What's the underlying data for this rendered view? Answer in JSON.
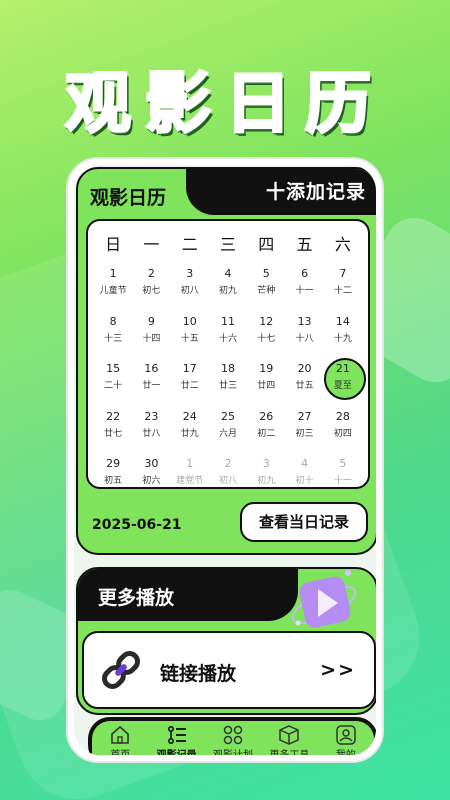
{
  "hero": {
    "title": "观影日历"
  },
  "calendar": {
    "title": "观影日历",
    "add_label": "十添加记录",
    "weekdays": [
      "日",
      "一",
      "二",
      "三",
      "四",
      "五",
      "六"
    ],
    "selected_date": "2025-06-21",
    "view_button": "查看当日记录",
    "days": [
      {
        "n": "1",
        "l": "儿童节"
      },
      {
        "n": "2",
        "l": "初七"
      },
      {
        "n": "3",
        "l": "初八"
      },
      {
        "n": "4",
        "l": "初九"
      },
      {
        "n": "5",
        "l": "芒种"
      },
      {
        "n": "6",
        "l": "十一"
      },
      {
        "n": "7",
        "l": "十二"
      },
      {
        "n": "8",
        "l": "十三"
      },
      {
        "n": "9",
        "l": "十四"
      },
      {
        "n": "10",
        "l": "十五"
      },
      {
        "n": "11",
        "l": "十六"
      },
      {
        "n": "12",
        "l": "十七"
      },
      {
        "n": "13",
        "l": "十八"
      },
      {
        "n": "14",
        "l": "十九"
      },
      {
        "n": "15",
        "l": "二十"
      },
      {
        "n": "16",
        "l": "廿一"
      },
      {
        "n": "17",
        "l": "廿二"
      },
      {
        "n": "18",
        "l": "廿三"
      },
      {
        "n": "19",
        "l": "廿四"
      },
      {
        "n": "20",
        "l": "廿五"
      },
      {
        "n": "21",
        "l": "夏至",
        "selected": true
      },
      {
        "n": "22",
        "l": "廿七"
      },
      {
        "n": "23",
        "l": "廿八"
      },
      {
        "n": "24",
        "l": "廿九"
      },
      {
        "n": "25",
        "l": "六月"
      },
      {
        "n": "26",
        "l": "初二"
      },
      {
        "n": "27",
        "l": "初三"
      },
      {
        "n": "28",
        "l": "初四"
      },
      {
        "n": "29",
        "l": "初五"
      },
      {
        "n": "30",
        "l": "初六"
      },
      {
        "n": "1",
        "l": "建党节",
        "other": true
      },
      {
        "n": "2",
        "l": "初八",
        "other": true
      },
      {
        "n": "3",
        "l": "初九",
        "other": true
      },
      {
        "n": "4",
        "l": "初十",
        "other": true
      },
      {
        "n": "5",
        "l": "十一",
        "other": true
      }
    ]
  },
  "more": {
    "title": "更多播放",
    "link_label": "链接播放",
    "link_arrow": ">>",
    "art_icon": "play-3d-icon",
    "link_icon": "chain-link-icon"
  },
  "nav": {
    "items": [
      {
        "label": "首页",
        "icon": "home-icon"
      },
      {
        "label": "观影记录",
        "icon": "record-list-icon",
        "active": true
      },
      {
        "label": "观影计划",
        "icon": "plan-grid-icon"
      },
      {
        "label": "更多工具",
        "icon": "box-icon"
      },
      {
        "label": "我的",
        "icon": "profile-icon"
      }
    ]
  },
  "colors": {
    "accent": "#7fe35c",
    "dark": "#111111",
    "background_top": "#b5f06a",
    "background_bottom": "#3ee3a4"
  }
}
